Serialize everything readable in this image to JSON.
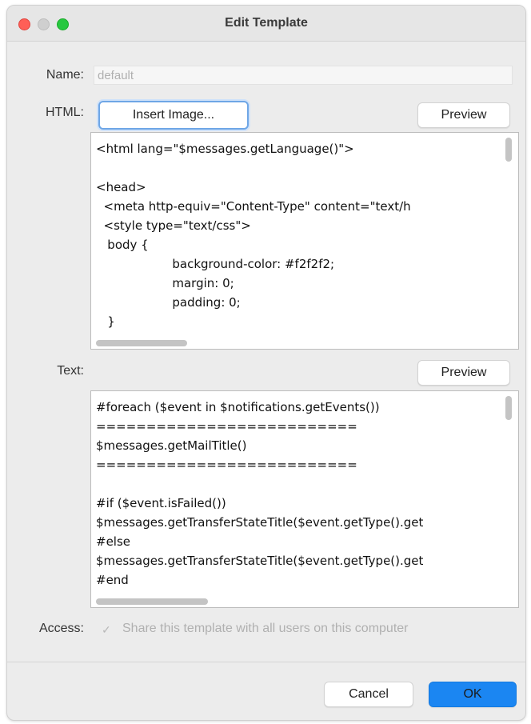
{
  "window": {
    "title": "Edit Template"
  },
  "form": {
    "name_label": "Name:",
    "name_placeholder": "default",
    "html_label": "HTML:",
    "insert_image_label": "Insert Image...",
    "preview_label": "Preview",
    "text_label": "Text:",
    "access_label": "Access:",
    "share_label": "Share this template with all users on this computer",
    "share_checked": true
  },
  "html_editor": {
    "lines": [
      "<html lang=\"$messages.getLanguage()\">",
      "",
      "<head>",
      "  <meta http-equiv=\"Content-Type\" content=\"text/h",
      "  <style type=\"text/css\">",
      "   body {",
      "                    background-color: #f2f2f2;",
      "                    margin: 0;",
      "                    padding: 0;",
      "   }"
    ]
  },
  "text_editor": {
    "lines": [
      "#foreach ($event in $notifications.getEvents())",
      "==========================",
      "$messages.getMailTitle()",
      "==========================",
      "",
      "#if ($event.isFailed())",
      "$messages.getTransferStateTitle($event.getType().get",
      "#else",
      "$messages.getTransferStateTitle($event.getType().get",
      "#end"
    ]
  },
  "footer": {
    "cancel_label": "Cancel",
    "ok_label": "OK"
  },
  "colors": {
    "accent": "#1b86f2",
    "close": "#ff5f57",
    "maximize": "#28c840"
  }
}
